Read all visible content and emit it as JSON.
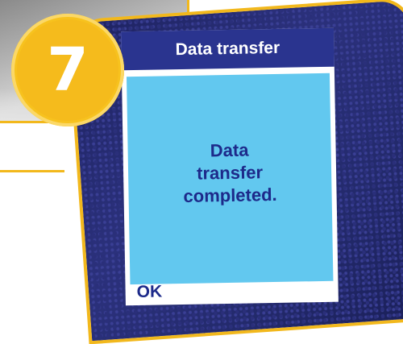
{
  "step": {
    "number": "7"
  },
  "screen": {
    "title": "Data transfer",
    "message_lines": [
      "Data",
      "transfer",
      "completed."
    ],
    "ok_label": "OK"
  },
  "colors": {
    "accent": "#f7c21e",
    "title_bar": "#2a348f",
    "message_bg": "#62c8ef",
    "text": "#1d2a8a"
  }
}
